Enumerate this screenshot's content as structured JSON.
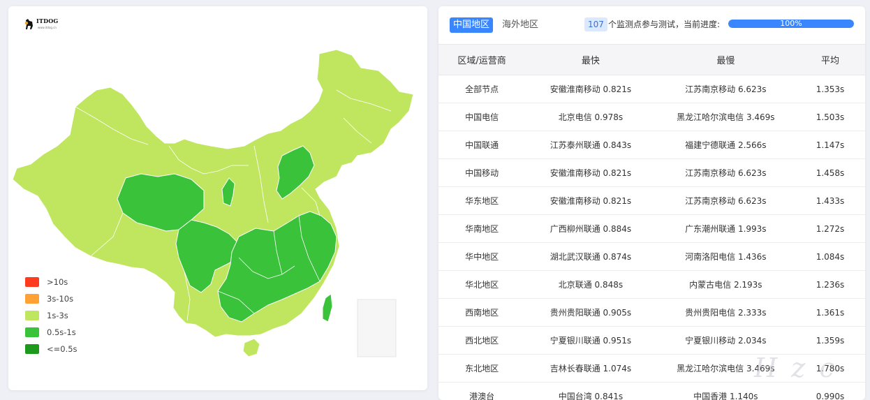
{
  "logo": {
    "text": "ITDOG",
    "sub": "www.itdog.cn"
  },
  "colors": {
    "over10": "#ff3b1f",
    "s3to10": "#ffa135",
    "s1to3": "#bfe65e",
    "s05to1": "#3ac23a",
    "under05": "#1d9a1d",
    "accent": "#3a86ff"
  },
  "legend": [
    {
      "label": ">10s",
      "color": "#ff3b1f"
    },
    {
      "label": "3s-10s",
      "color": "#ffa135"
    },
    {
      "label": "1s-3s",
      "color": "#bfe65e"
    },
    {
      "label": "0.5s-1s",
      "color": "#3ac23a"
    },
    {
      "label": "<=0.5s",
      "color": "#1d9a1d"
    }
  ],
  "tabs": {
    "china": "中国地区",
    "overseas": "海外地区"
  },
  "progress": {
    "count": "107",
    "label": "个监测点参与测试，当前进度:",
    "percent_text": "100%",
    "percent": 100
  },
  "table": {
    "headers": [
      "区域/运营商",
      "最快",
      "最慢",
      "平均"
    ],
    "rows": [
      [
        "全部节点",
        "安徽淮南移动 0.821s",
        "江苏南京移动 6.623s",
        "1.353s"
      ],
      [
        "中国电信",
        "北京电信 0.978s",
        "黑龙江哈尔滨电信 3.469s",
        "1.503s"
      ],
      [
        "中国联通",
        "江苏泰州联通 0.843s",
        "福建宁德联通 2.566s",
        "1.147s"
      ],
      [
        "中国移动",
        "安徽淮南移动 0.821s",
        "江苏南京移动 6.623s",
        "1.458s"
      ],
      [
        "华东地区",
        "安徽淮南移动 0.821s",
        "江苏南京移动 6.623s",
        "1.433s"
      ],
      [
        "华南地区",
        "广西柳州联通 0.884s",
        "广东潮州联通 1.993s",
        "1.272s"
      ],
      [
        "华中地区",
        "湖北武汉联通 0.874s",
        "河南洛阳电信 1.436s",
        "1.084s"
      ],
      [
        "华北地区",
        "北京联通 0.848s",
        "内蒙古电信 2.193s",
        "1.236s"
      ],
      [
        "西南地区",
        "贵州贵阳联通 0.905s",
        "贵州贵阳电信 2.333s",
        "1.361s"
      ],
      [
        "西北地区",
        "宁夏银川联通 0.951s",
        "宁夏银川移动 2.034s",
        "1.359s"
      ],
      [
        "东北地区",
        "吉林长春联通 1.074s",
        "黑龙江哈尔滨电信 3.469s",
        "1.780s"
      ],
      [
        "港澳台",
        "中国台湾 0.841s",
        "中国香港 1.140s",
        "0.990s"
      ]
    ]
  },
  "watermark": "H z c"
}
